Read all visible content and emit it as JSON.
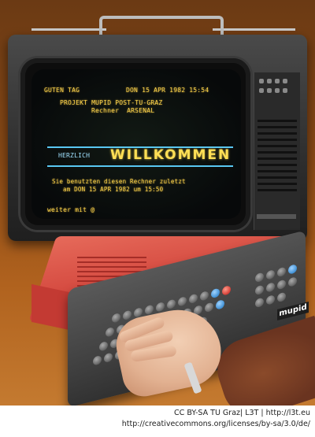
{
  "screen": {
    "line1_left": "GUTEN TAG",
    "line1_right": "DON 15 APR 1982 15:54",
    "line2": "PROJEKT MUPID POST-TU-GRAZ",
    "line3": "Rechner  ARSENAL",
    "banner_small": "HERZLICH",
    "banner_title": "WILLKOMMEN",
    "line4": "Sie benutzten diesen Rechner zuletzt",
    "line5": "am DON 15 APR 1982 um 15:50",
    "prompt": "weiter mit @"
  },
  "keyboard_brand": "mupid",
  "caption": {
    "line1": "CC BY-SA TU Graz| L3T | http://l3t.eu",
    "line2": "http://creativecommons.org/licenses/by-sa/3.0/de/"
  },
  "colors": {
    "screen_text": "#ffd54a",
    "banner_rule": "#59c7f2",
    "console_red": "#d4493f",
    "keyboard_gray": "#3f3f3f"
  }
}
